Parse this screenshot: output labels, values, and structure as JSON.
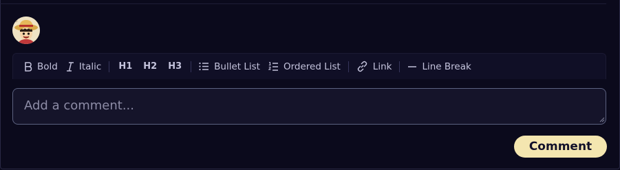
{
  "avatar": {
    "icon": "straw-hat-character-avatar"
  },
  "toolbar": {
    "bold": {
      "label": "Bold",
      "icon": "bold-icon"
    },
    "italic": {
      "label": "Italic",
      "icon": "italic-icon"
    },
    "h1": "H1",
    "h2": "H2",
    "h3": "H3",
    "bullet_list": {
      "label": "Bullet List",
      "icon": "bullet-list-icon"
    },
    "ordered_list": {
      "label": "Ordered List",
      "icon": "ordered-list-icon"
    },
    "link": {
      "label": "Link",
      "icon": "link-icon"
    },
    "line_break": {
      "label": "Line Break",
      "icon": "horizontal-rule-icon"
    }
  },
  "comment": {
    "placeholder": "Add a comment...",
    "value": ""
  },
  "submit": {
    "label": "Comment"
  },
  "colors": {
    "background": "#0b0a1c",
    "toolbar_bg": "#100f26",
    "input_border": "#5c6280",
    "button_bg": "#f4e6b0",
    "button_text": "#12112a"
  }
}
